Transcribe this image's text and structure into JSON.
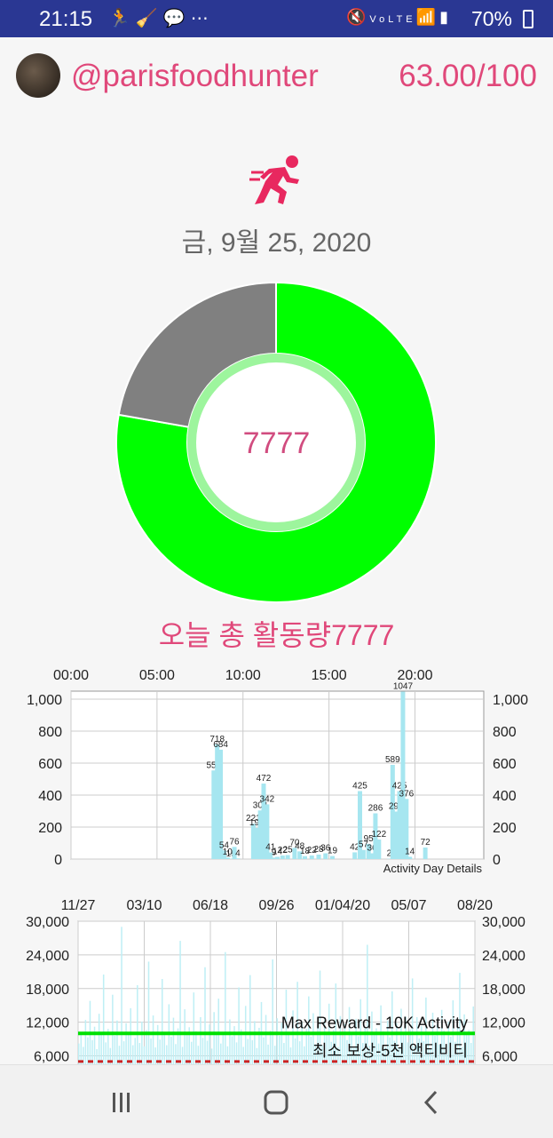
{
  "status_bar": {
    "time": "21:15",
    "left_icons": [
      "runner-icon",
      "broom-icon",
      "chat-icon",
      "more-icon"
    ],
    "right_icons": [
      "mute-icon",
      "volte-icon",
      "wifi-icon",
      "signal-icon"
    ],
    "battery": "70%"
  },
  "header": {
    "username": "@parisfoodhunter",
    "score": "63.00/100"
  },
  "date": "금, 9월 25, 2020",
  "donut": {
    "center_value": "7777",
    "colors": {
      "progress": "#00ff00",
      "remaining": "#808080",
      "ring": "#9df59d"
    },
    "progress_fraction": 0.7777
  },
  "total_label": "오늘 총 활동량7777",
  "chart_data": [
    {
      "type": "bar",
      "x_ticks": [
        "00:00",
        "05:00",
        "10:00",
        "15:00",
        "20:00"
      ],
      "y_ticks": [
        "0",
        "200",
        "400",
        "600",
        "800",
        "1,000"
      ],
      "ylim": [
        0,
        1050
      ],
      "xlim": [
        0,
        24
      ],
      "color": "#a6e6f0",
      "label": "Activity Day Details",
      "points": [
        {
          "x": 8.3,
          "y": 554,
          "label": "554"
        },
        {
          "x": 8.5,
          "y": 718,
          "label": "718"
        },
        {
          "x": 8.7,
          "y": 684,
          "label": "684"
        },
        {
          "x": 8.9,
          "y": 54,
          "label": "54"
        },
        {
          "x": 9.1,
          "y": 10,
          "label": "10"
        },
        {
          "x": 9.3,
          "y": 0,
          "label": "19"
        },
        {
          "x": 9.5,
          "y": 76,
          "label": "76"
        },
        {
          "x": 9.7,
          "y": 4,
          "label": "4"
        },
        {
          "x": 10.6,
          "y": 221,
          "label": "221"
        },
        {
          "x": 10.8,
          "y": 195,
          "label": "195"
        },
        {
          "x": 11.0,
          "y": 304,
          "label": "304"
        },
        {
          "x": 11.2,
          "y": 472,
          "label": "472"
        },
        {
          "x": 11.4,
          "y": 342,
          "label": "342"
        },
        {
          "x": 11.6,
          "y": 41,
          "label": "41"
        },
        {
          "x": 11.8,
          "y": 9,
          "label": "9"
        },
        {
          "x": 12.0,
          "y": 14,
          "label": "14"
        },
        {
          "x": 12.3,
          "y": 22,
          "label": "22"
        },
        {
          "x": 12.6,
          "y": 25,
          "label": "25"
        },
        {
          "x": 13.0,
          "y": 70,
          "label": "70"
        },
        {
          "x": 13.3,
          "y": 48,
          "label": "48"
        },
        {
          "x": 13.6,
          "y": 18,
          "label": "18"
        },
        {
          "x": 14.0,
          "y": 22,
          "label": "22"
        },
        {
          "x": 14.4,
          "y": 28,
          "label": "28"
        },
        {
          "x": 14.8,
          "y": 36,
          "label": "36"
        },
        {
          "x": 15.2,
          "y": 19,
          "label": "19"
        },
        {
          "x": 16.5,
          "y": 42,
          "label": "42"
        },
        {
          "x": 16.8,
          "y": 425,
          "label": "425"
        },
        {
          "x": 17.0,
          "y": 57,
          "label": "57"
        },
        {
          "x": 17.3,
          "y": 95,
          "label": "95"
        },
        {
          "x": 17.5,
          "y": 36,
          "label": "36"
        },
        {
          "x": 17.7,
          "y": 286,
          "label": "286"
        },
        {
          "x": 17.9,
          "y": 122,
          "label": "122"
        },
        {
          "x": 18.5,
          "y": 2,
          "label": "2"
        },
        {
          "x": 18.7,
          "y": 589,
          "label": "589"
        },
        {
          "x": 18.9,
          "y": 297,
          "label": "297"
        },
        {
          "x": 19.1,
          "y": 425,
          "label": "425"
        },
        {
          "x": 19.3,
          "y": 1047,
          "label": "1047"
        },
        {
          "x": 19.5,
          "y": 376,
          "label": "376"
        },
        {
          "x": 19.7,
          "y": 14,
          "label": "14"
        },
        {
          "x": 20.6,
          "y": 72,
          "label": "72"
        }
      ]
    },
    {
      "type": "bar",
      "x_ticks": [
        "11/27",
        "03/10",
        "06/18",
        "09/26",
        "01/04/20",
        "05/07",
        "08/20"
      ],
      "y_ticks": [
        "6,000",
        "12,000",
        "18,000",
        "24,000",
        "30,000"
      ],
      "ylim": [
        4500,
        30000
      ],
      "color": "#bfeff5",
      "reference_lines": [
        {
          "label": "Max Reward - 10K Activity",
          "value": 10000,
          "color": "#00e000",
          "style": "solid"
        },
        {
          "label": "최소 보상-5천 액티비티",
          "value": 5000,
          "color": "#cc2222",
          "style": "dashed"
        }
      ],
      "values": [
        8200,
        10100,
        7600,
        12400,
        9300,
        15800,
        8800,
        11200,
        7200,
        13500,
        9800,
        20500,
        8400,
        10800,
        7400,
        16900,
        9600,
        12300,
        7800,
        29000,
        8600,
        11800,
        10200,
        14500,
        7900,
        9200,
        18600,
        8300,
        12100,
        7700,
        10600,
        22800,
        9100,
        13200,
        7500,
        11500,
        8900,
        19700,
        10300,
        7900,
        15200,
        9400,
        12800,
        8100,
        10900,
        26500,
        7600,
        14300,
        9700,
        11100,
        8500,
        17300,
        10400,
        7800,
        12900,
        9200,
        21800,
        8700,
        11600,
        7300,
        13800,
        10100,
        16200,
        8200,
        9900,
        24500,
        7700,
        12500,
        9500,
        11300,
        8400,
        18200,
        10700,
        7600,
        14900,
        9000,
        20400,
        8800,
        12200,
        7400,
        11000,
        15600,
        9300,
        13300,
        8000,
        10500,
        23200,
        7800,
        12700,
        9600,
        11900,
        8300,
        17800,
        10300,
        7500,
        14100,
        9100,
        19200,
        8600,
        12000,
        7700,
        10800,
        16600,
        9400,
        13600,
        8100,
        11400,
        21200,
        7900,
        12400,
        9800,
        15300,
        8500,
        10600,
        18900,
        7600,
        13100,
        9200,
        11700,
        8800,
        14700,
        10200,
        7400,
        12600,
        9500,
        16100,
        8300,
        11200,
        25800,
        7800,
        13900,
        9700,
        10900,
        8200,
        15000,
        10400,
        7600,
        12300,
        9300,
        17500,
        8700,
        11800,
        7500,
        14400,
        9900,
        13000,
        8400,
        10700,
        19800,
        7700,
        12900,
        9100,
        11300,
        8600,
        16400,
        10100,
        7300,
        13700,
        9600,
        11600,
        8000,
        14200,
        10500,
        7800,
        12100,
        9400,
        15900,
        8500,
        11000,
        20800,
        7600,
        13400,
        9800,
        10600,
        8300,
        14800
      ]
    }
  ],
  "nav_bar": [
    "recent-apps-button",
    "home-button",
    "back-button"
  ]
}
